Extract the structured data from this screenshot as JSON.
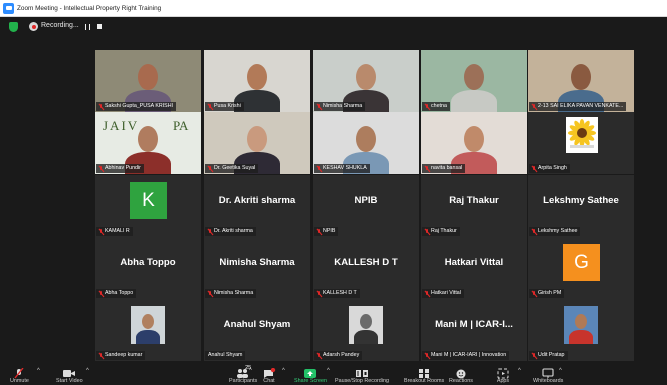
{
  "window": {
    "title": "Zoom Meeting - Intellectual Property Right Training"
  },
  "recording": {
    "label": "Recording..."
  },
  "participants": [
    {
      "name": "Sakshi Gupta_PUSA KRISHI",
      "type": "video",
      "bg": "#8e8a76",
      "skin": "#a86a4e",
      "shirt": "#6b5d78",
      "active": true
    },
    {
      "name": "Pusa Krishi",
      "type": "video",
      "bg": "#d8d6d0",
      "skin": "#b27a58",
      "shirt": "#2e3134"
    },
    {
      "name": "Nimisha Sharma",
      "type": "video",
      "bg": "#c9ceca",
      "skin": "#b98a6c",
      "shirt": "#3a3436"
    },
    {
      "name": "chetna",
      "type": "video",
      "bg": "#9bb7a2",
      "skin": "#9c7058",
      "shirt": "#c7c9c4"
    },
    {
      "name": "2-13 SAI ELIKA PAVAN VENKATE...",
      "type": "video",
      "bg": "#c3b29a",
      "skin": "#8a5a40",
      "shirt": "#4a6c8d"
    },
    {
      "name": "Abhinav Pundir",
      "type": "video",
      "bg": "#e7ebe4",
      "skin": "#b07c5f",
      "shirt": "#8c2f2a",
      "extra": "jaivik"
    },
    {
      "name": "Dr. Geetika Suyal",
      "type": "video",
      "bg": "#cfc9bd",
      "skin": "#c99a7e",
      "shirt": "#2e2a35"
    },
    {
      "name": "KESHAV SHUKLA",
      "type": "video",
      "bg": "#dcdcdc",
      "skin": "#ad7d5e",
      "shirt": "#7a98b5"
    },
    {
      "name": "navita bansal",
      "type": "video",
      "bg": "#e3dcd6",
      "skin": "#c08a6a",
      "shirt": "#c25b5b"
    },
    {
      "name": "Arpita Singh",
      "type": "image",
      "bg": "#ffffff"
    },
    {
      "name": "KAMALI R",
      "type": "letter",
      "letter": "K",
      "color": "#2fa33f"
    },
    {
      "name": "Dr. Akriti sharma",
      "type": "text",
      "display": "Dr. Akriti sharma"
    },
    {
      "name": "NPIB",
      "type": "text",
      "display": "NPIB"
    },
    {
      "name": "Raj Thakur",
      "type": "text",
      "display": "Raj Thakur"
    },
    {
      "name": "Lekshmy Sathee",
      "type": "text",
      "display": "Lekshmy Sathee"
    },
    {
      "name": "Abha Toppo",
      "type": "text",
      "display": "Abha Toppo"
    },
    {
      "name": "Nimisha Sharma",
      "type": "text",
      "display": "Nimisha Sharma"
    },
    {
      "name": "KALLESH D T",
      "type": "text",
      "display": "KALLESH  D  T"
    },
    {
      "name": "Hatkari Vittal",
      "type": "text",
      "display": "Hatkari Vittal"
    },
    {
      "name": "Girish PM",
      "type": "letter",
      "letter": "G",
      "color": "#f5901e"
    },
    {
      "name": "Sandeep kumar",
      "type": "photo",
      "bg": "#cfd5d8",
      "skin": "#b0805f",
      "shirt": "#2c3e6a"
    },
    {
      "name": "Anahul Shyam",
      "type": "text",
      "display": "Anahul Shyam",
      "muted": false
    },
    {
      "name": "Adarsh Pandey",
      "type": "photo",
      "bg": "#d9d9d9",
      "skin": "#6a6a6a",
      "shirt": "#333333"
    },
    {
      "name": "Mani M | ICAR-IARI | Innovation",
      "type": "text",
      "display": "Mani M | ICAR-I..."
    },
    {
      "name": "Udit Pratap",
      "type": "photo",
      "bg": "#5b86b8",
      "skin": "#b07a56",
      "shirt": "#c8342c"
    }
  ],
  "toolbar": {
    "participants_count": "25",
    "items": [
      {
        "id": "unmute",
        "label": "Unmute",
        "icon": "mic-muted-icon"
      },
      {
        "id": "start_video",
        "label": "Start Video",
        "icon": "video-off-icon"
      },
      {
        "id": "participants",
        "label": "Participants",
        "icon": "participants-icon"
      },
      {
        "id": "chat",
        "label": "Chat",
        "icon": "chat-icon"
      },
      {
        "id": "share_screen",
        "label": "Share Screen",
        "icon": "share-screen-icon"
      },
      {
        "id": "record",
        "label": "Pause/Stop Recording",
        "icon": "record-icon"
      },
      {
        "id": "breakout",
        "label": "Breakout Rooms",
        "icon": "breakout-rooms-icon"
      },
      {
        "id": "reactions",
        "label": "Reactions",
        "icon": "reactions-icon"
      },
      {
        "id": "apps",
        "label": "Apps",
        "icon": "apps-icon"
      },
      {
        "id": "whiteboards",
        "label": "Whiteboards",
        "icon": "whiteboard-icon"
      }
    ]
  }
}
